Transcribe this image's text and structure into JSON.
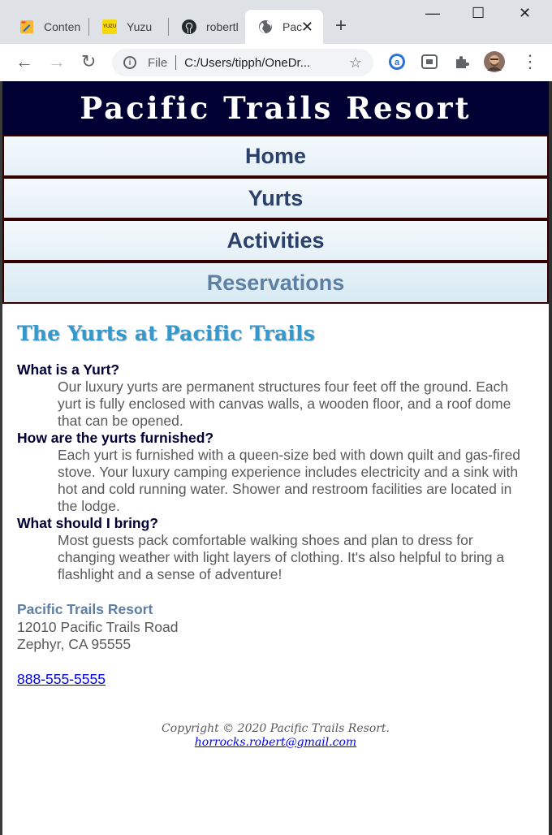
{
  "browser": {
    "tabs": [
      {
        "label": "Conten",
        "icon": "pencil-icon"
      },
      {
        "label": "Yuzu",
        "icon": "yuzu-icon"
      },
      {
        "label": "robertl",
        "icon": "github-icon"
      },
      {
        "label": "Pac",
        "icon": "globe-icon",
        "active": true
      }
    ],
    "favicon_text": {
      "yuzu": "YUZU"
    },
    "window_controls": {
      "minimize": "—",
      "maximize": "☐",
      "close": "✕"
    },
    "new_tab": "+",
    "close_tab": "✕",
    "nav": {
      "back": "←",
      "forward": "→",
      "reload": "↻"
    },
    "address": {
      "info": "i",
      "scheme_label": "File",
      "url": "C:/Users/tipph/OneDr..."
    },
    "star": "☆",
    "menu": "⋮",
    "colors": {
      "frame": "#dee1e6",
      "toolbar": "#ffffff"
    }
  },
  "site": {
    "banner_title": "Pacific Trails Resort",
    "nav": [
      "Home",
      "Yurts",
      "Activities",
      "Reservations"
    ],
    "heading": "The Yurts at Pacific Trails",
    "faq": [
      {
        "q": "What is a Yurt?",
        "a": "Our luxury yurts are permanent structures four feet off the ground. Each yurt is fully enclosed with canvas walls, a wooden floor, and a roof dome that can be opened."
      },
      {
        "q": "How are the yurts furnished?",
        "a": "Each yurt is furnished with a queen-size bed with down quilt and gas-fired stove. Your luxury camping experience includes electricity and a sink with hot and cold running water. Shower and restroom facilities are located in the lodge."
      },
      {
        "q": "What should I bring?",
        "a": "Most guests pack comfortable walking shoes and plan to dress for changing weather with light layers of clothing. It's also helpful to bring a flashlight and a sense of adventure!"
      }
    ],
    "contact": {
      "name": "Pacific Trails Resort",
      "street": "12010 Pacific Trails Road",
      "city": "Zephyr, CA 95555",
      "phone": "888-555-5555"
    },
    "footer": {
      "copyright": "Copyright © 2020 Pacific Trails Resort.",
      "email": "horrocks.robert@gmail.com"
    },
    "colors": {
      "banner_bg": "#000033",
      "nav_border": "#330000",
      "heading": "#3399cc",
      "text": "#595959",
      "link": "#0000ee"
    }
  }
}
